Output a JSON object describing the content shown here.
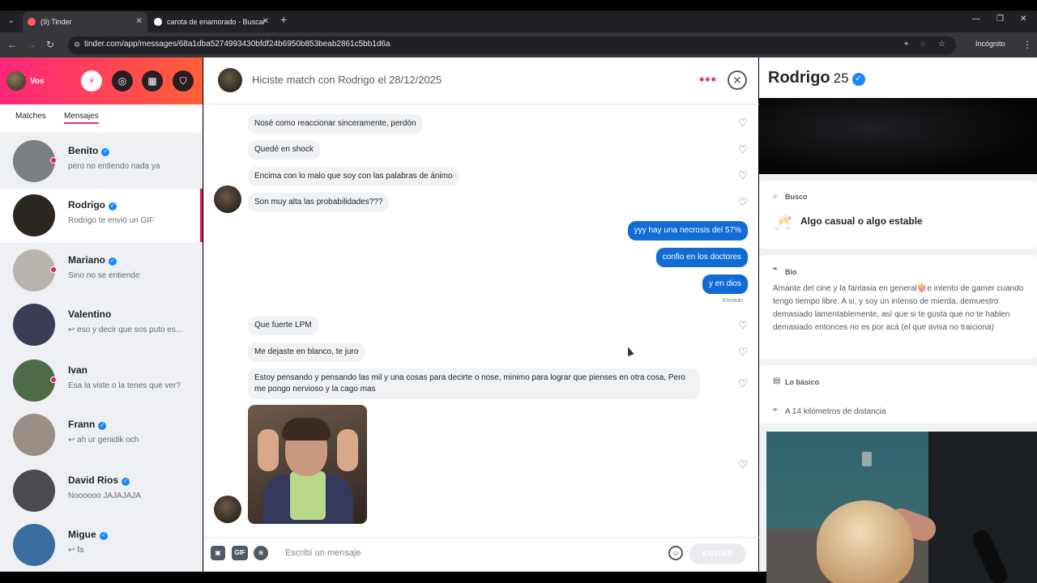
{
  "browser": {
    "tabs": [
      {
        "title": "(9) Tinder",
        "fav_color": "#ff5a5f",
        "active": true
      },
      {
        "title": "carota de enamorado - Buscar",
        "fav_color": "#ffffff",
        "active": false
      }
    ],
    "url": "tinder.com/app/messages/68a1dba5274993430bfdf24b6950b853beab2861c5bb1d6a",
    "incognito_label": "Incógnito"
  },
  "sidebar": {
    "me_label": "Vos",
    "tabs": [
      {
        "label": "Matches"
      },
      {
        "label": "Mensajes"
      }
    ],
    "conversations": [
      {
        "name": "Benito",
        "verified": true,
        "preview": "pero no entiendo nada ya",
        "unread": true,
        "avatar_color": "#7a7f84"
      },
      {
        "name": "Rodrigo",
        "verified": true,
        "preview": "Rodrigo te envió un GIF",
        "unread": false,
        "active": true,
        "avatar_color": "#2b2620"
      },
      {
        "name": "Mariano",
        "verified": true,
        "preview": "Sino no se entiende",
        "unread": true,
        "avatar_color": "#b9b5ad"
      },
      {
        "name": "Valentino",
        "verified": false,
        "preview": "↩ eso y decir que sos puto es...",
        "unread": false,
        "avatar_color": "#3b3d57"
      },
      {
        "name": "Ivan",
        "verified": false,
        "preview": "Esa la viste o la tenes que ver?",
        "unread": true,
        "avatar_color": "#4d6b44"
      },
      {
        "name": "Frann",
        "verified": true,
        "preview": "↩ ah ur genidik och",
        "unread": false,
        "avatar_color": "#9a8f86"
      },
      {
        "name": "David Rios",
        "verified": true,
        "preview": "Noooooo JAJAJAJA",
        "unread": false,
        "avatar_color": "#4a4a4f"
      },
      {
        "name": "Migue",
        "verified": true,
        "preview": "↩ fa",
        "unread": false,
        "avatar_color": "#3a6da0"
      }
    ]
  },
  "chat": {
    "header": "Hiciste match con Rodrigo el 28/12/2025",
    "messages": [
      {
        "text": "Nosé como reaccionar sinceramente, perdón",
        "dir": "in"
      },
      {
        "text": "Quedé en shock",
        "dir": "in"
      },
      {
        "text": "Encima con lo malo que soy con las palabras de ánimo",
        "dir": "in"
      },
      {
        "text": "Son muy alta las probabilidades???",
        "dir": "in"
      },
      {
        "text": "yyy hay una necrosis del 57%",
        "dir": "out"
      },
      {
        "text": "confio en los doctores",
        "dir": "out"
      },
      {
        "text": "y en dios",
        "dir": "out"
      },
      {
        "text": "Que fuerte LPM",
        "dir": "in"
      },
      {
        "text": "Me dejaste en blanco, te juro",
        "dir": "in"
      },
      {
        "text": "Estoy pensando y pensando las mil y una cosas para decirte o nose, minimo para lograr que pienses en otra cosa, Pero me pongo nervioso y la cago mas",
        "dir": "in"
      }
    ],
    "sent_label": "Enviado",
    "composer": {
      "gif_label": "GIF",
      "placeholder": "Escribí un mensaje",
      "send_label": "ENVIAR"
    }
  },
  "profile": {
    "name": "Rodrigo",
    "age": "25",
    "looking_title": "Busco",
    "looking_value": "Algo casual o algo estable",
    "bio_title": "Bio",
    "bio": "Amante del cine y la fantasia en general🍿e intento de gamer cuando tengo tiempo libre. A si, y soy un intenso de mierda, demuestro demasiado lamentablemente, así que si te gusta que no te hablen demasiado entonces no es por acá (el que avisa no traiciona)",
    "basics_title": "Lo básico",
    "distance": "A 14 kilómetros de distancia"
  },
  "colors": {
    "brand_gradient_start": "#fd267a",
    "brand_gradient_end": "#ff6036",
    "outgoing_bubble": "#106bd5",
    "verified_badge": "#1786ff"
  }
}
